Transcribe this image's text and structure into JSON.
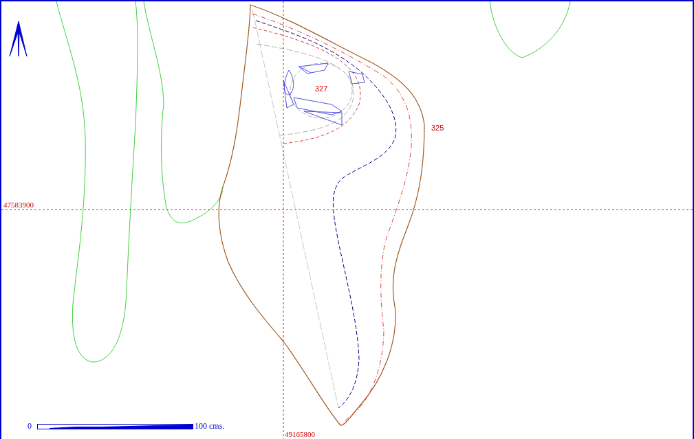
{
  "grid_labels": [
    {
      "kind": "northing",
      "text": "47583900"
    },
    {
      "kind": "easting",
      "text": "49165800"
    }
  ],
  "contour_labels": [
    {
      "kind": "inner",
      "text": "327"
    },
    {
      "kind": "outer",
      "text": "325"
    }
  ],
  "scale_bar": {
    "start": "0",
    "end": "100 cms."
  }
}
